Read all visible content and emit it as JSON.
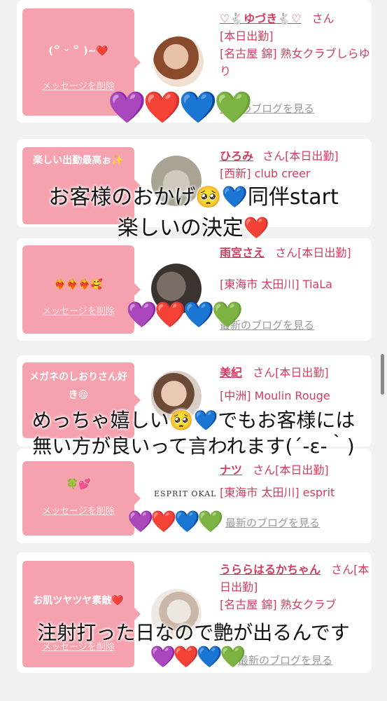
{
  "common": {
    "delete_label": "メッセージを削除",
    "blog_label": "最新のブログを見る",
    "san": "さん"
  },
  "items": [
    {
      "message": "(꒪ ᵕ ꒪ )~❤️",
      "name": "♡🐇ゆづき🐇♡",
      "status": "[本日出勤]",
      "location": "[名古屋 錦] 熟女クラブしらゆり",
      "hearts": "💜❤️💙💚"
    },
    {
      "message": "楽しい出勤最高ぉ✨",
      "name": "ひろみ",
      "status": "[本日出勤]",
      "location": "[西新] club creer"
    },
    {
      "message": "❤️‍🔥❤️‍🔥❤️‍🔥🥰",
      "name": "雨宮さえ",
      "status": "[本日出勤]",
      "location": "[東海市 太田川] TiaLa",
      "hearts": "💜❤️💙💚"
    },
    {
      "message": "メガネのしおりさん好き😆",
      "name": "美紀",
      "status": "[本日出勤]",
      "location": "[中洲] Moulin Rouge"
    },
    {
      "message": "🍀💕",
      "name": "ナツ",
      "status": "[本日出勤]",
      "location": "[東海市 太田川] esprit",
      "logo_text": "ESPRIT OKAL",
      "hearts": "💜❤️💙💚"
    },
    {
      "message": "お肌ツヤツヤ素敵❤️",
      "name": "うららはるかちゃん",
      "status": "[本日出勤]",
      "location": "[名古屋 錦] 熟女クラブ",
      "hearts": "💜❤️💙💚"
    }
  ],
  "overlays": [
    "お客様のおかげ🥺💙同伴start",
    "楽しいの決定❤️",
    "めっちゃ嬉しい🥺💙でもお客様には",
    "無い方が良いって言われます(´-ε-｀)",
    "注射打った日なので艶が出るんです"
  ]
}
